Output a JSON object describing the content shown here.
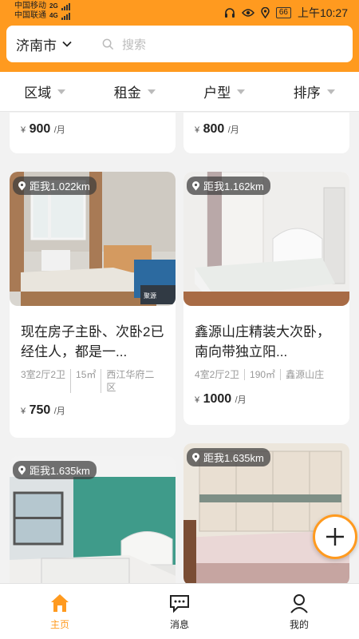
{
  "status": {
    "carrier1": "中国移动",
    "carrier2": "中国联通",
    "net1": "2G",
    "net2": "4G",
    "battery": "66",
    "time": "上午10:27"
  },
  "header": {
    "city": "济南市",
    "search_placeholder": "搜索"
  },
  "filters": [
    "区域",
    "租金",
    "户型",
    "排序"
  ],
  "listings_partial": [
    {
      "price": "900",
      "unit": "/月",
      "yen": "¥"
    },
    {
      "price": "800",
      "unit": "/月",
      "yen": "¥"
    }
  ],
  "listings": [
    {
      "distance": "距我1.022km",
      "title": "现在房子主卧、次卧2已经住人，都是一...",
      "layout": "3室2厅2卫",
      "area": "15㎡",
      "community": "西江华府二区",
      "price": "750",
      "unit": "/月",
      "yen": "¥"
    },
    {
      "distance": "距我1.162km",
      "title": "鑫源山庄精装大次卧，南向带独立阳...",
      "layout": "4室2厅2卫",
      "area": "190㎡",
      "community": "鑫源山庄",
      "price": "1000",
      "unit": "/月",
      "yen": "¥"
    },
    {
      "distance": "距我1.635km"
    },
    {
      "distance": "距我1.635km"
    }
  ],
  "tabs": [
    {
      "label": "主页",
      "icon": "home-icon"
    },
    {
      "label": "消息",
      "icon": "message-icon"
    },
    {
      "label": "我的",
      "icon": "profile-icon"
    }
  ],
  "colors": {
    "accent": "#ff9a1f"
  }
}
